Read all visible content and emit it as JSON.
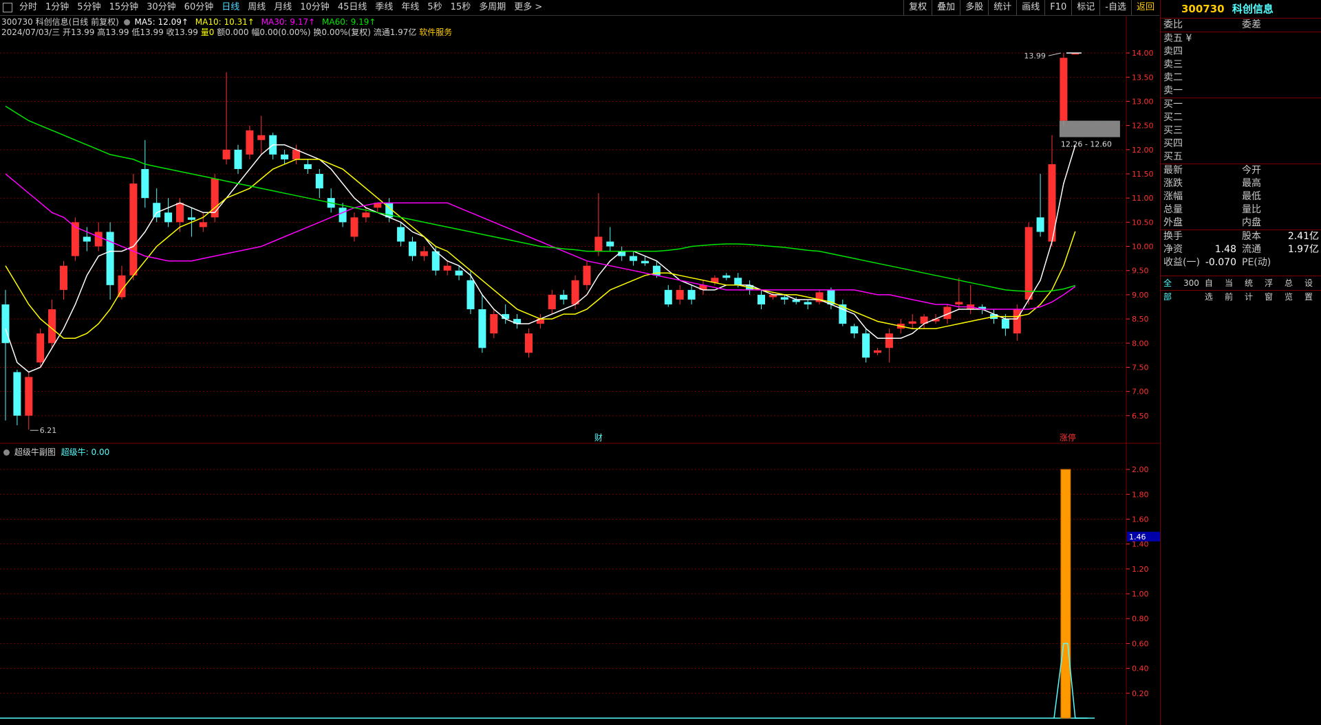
{
  "topbar": {
    "tabs": [
      "分时",
      "1分钟",
      "5分钟",
      "15分钟",
      "30分钟",
      "60分钟",
      "日线",
      "周线",
      "月线",
      "10分钟",
      "45日线",
      "季线",
      "年线",
      "5秒",
      "15秒",
      "多周期",
      "更多 >"
    ],
    "active": "日线"
  },
  "toolbar": {
    "buttons": [
      "复权",
      "叠加",
      "多股",
      "统计",
      "画线",
      "F10",
      "标记",
      "-自选",
      "返回"
    ]
  },
  "info1": {
    "stock": "300730 科创信息(日线 前复权)",
    "ma5": "MA5: 12.09↑",
    "ma10": "MA10: 10.31↑",
    "ma30": "MA30: 9.17↑",
    "ma60": "MA60: 9.19↑"
  },
  "info2": {
    "text": "2024/07/03/三 开13.99 高13.99 低13.99 收13.99",
    "vol": "量0",
    "amt": "额0.000",
    "rest": "幅0.00(0.00%) 换0.00%(复权) 流通1.97亿",
    "industry": "软件服务"
  },
  "subinfo": {
    "name": "超级牛副图",
    "value_label": "超级牛: 0.00"
  },
  "colors": {
    "up": "#ff3232",
    "down": "#54fcfc",
    "ma5": "#ffffff",
    "ma10": "#ffff00",
    "ma30": "#ff00ff",
    "ma60": "#00e600",
    "grid": "#7a0000",
    "axis": "#ff3232",
    "sub_bar": "#ff9900"
  },
  "annotations": {
    "high": "13.99",
    "low": "6.21",
    "band": "12.26 - 12.60",
    "cai": "财",
    "zt": "涨停",
    "sub_cursor": "1.46"
  },
  "chart_data": [
    {
      "type": "candlestick",
      "title": "300730 科创信息(日线 前复权)",
      "ylim": [
        6.0,
        14.3
      ],
      "y_ticks": [
        "14.00",
        "13.50",
        "13.00",
        "12.50",
        "12.00",
        "11.50",
        "11.00",
        "10.50",
        "10.00",
        "9.50",
        "9.00",
        "8.50",
        "8.00",
        "7.50",
        "7.00",
        "6.50"
      ],
      "candles": [
        [
          8.8,
          8.0,
          9.1,
          6.4
        ],
        [
          7.4,
          6.5,
          7.45,
          6.3
        ],
        [
          6.5,
          7.3,
          7.4,
          6.21
        ],
        [
          7.6,
          8.2,
          8.3,
          7.5
        ],
        [
          8.0,
          8.7,
          8.9,
          7.9
        ],
        [
          9.1,
          9.6,
          9.7,
          8.9
        ],
        [
          9.8,
          10.5,
          10.6,
          9.7
        ],
        [
          10.2,
          10.1,
          10.4,
          9.9
        ],
        [
          10.0,
          10.3,
          10.5,
          9.9
        ],
        [
          10.3,
          9.2,
          10.5,
          8.9
        ],
        [
          8.95,
          9.4,
          9.6,
          8.9
        ],
        [
          9.4,
          11.3,
          11.5,
          9.3
        ],
        [
          11.6,
          11.0,
          12.2,
          10.8
        ],
        [
          10.9,
          10.6,
          11.2,
          10.5
        ],
        [
          10.7,
          10.5,
          11.0,
          10.4
        ],
        [
          10.5,
          10.9,
          11.0,
          10.3
        ],
        [
          10.6,
          10.55,
          10.8,
          10.2
        ],
        [
          10.4,
          10.5,
          10.7,
          10.3
        ],
        [
          10.6,
          11.4,
          11.5,
          10.5
        ],
        [
          11.8,
          12.0,
          13.6,
          11.7
        ],
        [
          12.0,
          11.6,
          12.1,
          11.5
        ],
        [
          11.9,
          12.4,
          12.5,
          11.8
        ],
        [
          12.2,
          12.3,
          12.7,
          11.9
        ],
        [
          12.3,
          11.9,
          12.35,
          11.8
        ],
        [
          11.9,
          11.8,
          12.0,
          11.7
        ],
        [
          11.8,
          12.0,
          12.1,
          11.7
        ],
        [
          11.7,
          11.6,
          11.8,
          11.5
        ],
        [
          11.5,
          11.2,
          11.6,
          11.0
        ],
        [
          11.0,
          10.8,
          11.2,
          10.7
        ],
        [
          10.8,
          10.5,
          10.9,
          10.4
        ],
        [
          10.2,
          10.6,
          10.7,
          10.1
        ],
        [
          10.6,
          10.7,
          10.8,
          10.5
        ],
        [
          10.8,
          10.9,
          10.9,
          10.7
        ],
        [
          10.9,
          10.6,
          11.0,
          10.5
        ],
        [
          10.4,
          10.1,
          10.5,
          10.0
        ],
        [
          10.1,
          9.8,
          10.2,
          9.7
        ],
        [
          9.8,
          9.9,
          10.0,
          9.7
        ],
        [
          9.9,
          9.5,
          10.0,
          9.4
        ],
        [
          9.5,
          9.6,
          9.7,
          9.4
        ],
        [
          9.5,
          9.4,
          9.6,
          9.3
        ],
        [
          9.3,
          8.7,
          9.5,
          8.6
        ],
        [
          8.7,
          7.9,
          9.0,
          7.8
        ],
        [
          8.2,
          8.6,
          8.7,
          8.1
        ],
        [
          8.6,
          8.5,
          8.8,
          8.4
        ],
        [
          8.5,
          8.4,
          8.6,
          8.3
        ],
        [
          7.8,
          8.2,
          8.3,
          7.7
        ],
        [
          8.4,
          8.5,
          8.6,
          8.3
        ],
        [
          8.7,
          9.0,
          9.1,
          8.6
        ],
        [
          9.0,
          8.9,
          9.1,
          8.8
        ],
        [
          8.8,
          9.3,
          9.4,
          8.7
        ],
        [
          9.2,
          9.6,
          9.7,
          9.1
        ],
        [
          9.9,
          10.2,
          11.1,
          9.8
        ],
        [
          10.1,
          10.0,
          10.4,
          9.9
        ],
        [
          9.9,
          9.8,
          10.0,
          9.7
        ],
        [
          9.8,
          9.7,
          9.9,
          9.6
        ],
        [
          9.7,
          9.65,
          9.8,
          9.6
        ],
        [
          9.6,
          9.4,
          9.7,
          9.35
        ],
        [
          9.1,
          8.8,
          9.2,
          8.75
        ],
        [
          8.9,
          9.1,
          9.2,
          8.8
        ],
        [
          9.1,
          8.9,
          9.2,
          8.8
        ],
        [
          9.1,
          9.2,
          9.3,
          9.0
        ],
        [
          9.25,
          9.35,
          9.4,
          9.2
        ],
        [
          9.4,
          9.35,
          9.45,
          9.3
        ],
        [
          9.35,
          9.2,
          9.45,
          9.15
        ],
        [
          9.2,
          9.1,
          9.3,
          9.0
        ],
        [
          9.0,
          8.8,
          9.1,
          8.7
        ],
        [
          8.95,
          9.0,
          9.05,
          8.9
        ],
        [
          8.95,
          8.9,
          9.0,
          8.8
        ],
        [
          8.9,
          8.85,
          8.95,
          8.8
        ],
        [
          8.85,
          8.8,
          8.9,
          8.7
        ],
        [
          8.85,
          9.05,
          9.1,
          8.8
        ],
        [
          9.1,
          8.8,
          9.15,
          8.7
        ],
        [
          8.8,
          8.4,
          8.9,
          8.35
        ],
        [
          8.35,
          8.2,
          8.4,
          8.1
        ],
        [
          8.2,
          7.7,
          8.3,
          7.6
        ],
        [
          7.8,
          7.85,
          7.9,
          7.75
        ],
        [
          7.9,
          8.2,
          8.3,
          7.6
        ],
        [
          8.3,
          8.4,
          8.5,
          8.2
        ],
        [
          8.4,
          8.45,
          8.6,
          8.3
        ],
        [
          8.4,
          8.55,
          8.6,
          8.3
        ],
        [
          8.45,
          8.5,
          8.6,
          8.4
        ],
        [
          8.5,
          8.75,
          8.8,
          8.4
        ],
        [
          8.8,
          8.85,
          9.35,
          8.7
        ],
        [
          8.7,
          8.8,
          9.2,
          8.6
        ],
        [
          8.75,
          8.7,
          8.8,
          8.6
        ],
        [
          8.6,
          8.5,
          8.7,
          8.4
        ],
        [
          8.5,
          8.3,
          8.6,
          8.15
        ],
        [
          8.2,
          8.7,
          8.8,
          8.05
        ],
        [
          8.9,
          10.4,
          10.5,
          8.8
        ],
        [
          10.6,
          10.3,
          11.5,
          10.2
        ],
        [
          10.1,
          11.7,
          12.3,
          10.0
        ],
        [
          12.6,
          13.9,
          14.0,
          12.5
        ],
        [
          13.99,
          13.99,
          13.99,
          13.99
        ]
      ],
      "ma": {
        "MA5": [
          8.3,
          7.6,
          7.4,
          7.5,
          7.9,
          8.3,
          8.8,
          9.4,
          9.8,
          9.9,
          9.9,
          10.0,
          10.3,
          10.7,
          10.8,
          10.9,
          10.8,
          10.7,
          10.7,
          11.0,
          11.3,
          11.6,
          11.9,
          12.1,
          12.1,
          12.0,
          11.9,
          11.8,
          11.6,
          11.3,
          11.0,
          10.8,
          10.7,
          10.6,
          10.5,
          10.3,
          10.2,
          9.9,
          9.7,
          9.6,
          9.4,
          9.0,
          8.7,
          8.5,
          8.4,
          8.4,
          8.5,
          8.6,
          8.7,
          8.8,
          9.0,
          9.4,
          9.7,
          9.9,
          9.9,
          9.8,
          9.7,
          9.5,
          9.3,
          9.2,
          9.1,
          9.1,
          9.2,
          9.2,
          9.2,
          9.1,
          9.0,
          9.0,
          8.9,
          8.9,
          8.9,
          8.8,
          8.7,
          8.6,
          8.3,
          8.1,
          8.1,
          8.1,
          8.2,
          8.4,
          8.5,
          8.6,
          8.7,
          8.7,
          8.7,
          8.6,
          8.5,
          8.5,
          8.9,
          9.3,
          10.1,
          11.3,
          12.09
        ],
        "MA10": [
          9.6,
          9.2,
          8.8,
          8.5,
          8.3,
          8.1,
          8.1,
          8.2,
          8.4,
          8.7,
          9.1,
          9.4,
          9.7,
          10.0,
          10.2,
          10.4,
          10.5,
          10.6,
          10.8,
          11.0,
          11.1,
          11.2,
          11.4,
          11.6,
          11.7,
          11.8,
          11.8,
          11.8,
          11.7,
          11.6,
          11.4,
          11.2,
          11.0,
          10.8,
          10.6,
          10.4,
          10.2,
          10.0,
          9.9,
          9.7,
          9.5,
          9.3,
          9.1,
          8.9,
          8.7,
          8.6,
          8.5,
          8.5,
          8.6,
          8.6,
          8.7,
          8.9,
          9.1,
          9.2,
          9.3,
          9.4,
          9.45,
          9.45,
          9.4,
          9.35,
          9.3,
          9.25,
          9.2,
          9.2,
          9.15,
          9.1,
          9.05,
          9.0,
          9.0,
          8.95,
          8.9,
          8.85,
          8.75,
          8.65,
          8.55,
          8.45,
          8.4,
          8.35,
          8.3,
          8.3,
          8.3,
          8.35,
          8.4,
          8.45,
          8.5,
          8.55,
          8.55,
          8.55,
          8.6,
          8.8,
          9.1,
          9.6,
          10.31
        ],
        "MA30": [
          11.5,
          11.3,
          11.1,
          10.9,
          10.7,
          10.6,
          10.4,
          10.3,
          10.2,
          10.1,
          10.0,
          9.9,
          9.8,
          9.75,
          9.7,
          9.7,
          9.7,
          9.75,
          9.8,
          9.85,
          9.9,
          9.95,
          10.0,
          10.1,
          10.2,
          10.3,
          10.4,
          10.5,
          10.6,
          10.7,
          10.8,
          10.85,
          10.9,
          10.9,
          10.9,
          10.9,
          10.9,
          10.9,
          10.9,
          10.8,
          10.7,
          10.6,
          10.5,
          10.4,
          10.3,
          10.2,
          10.1,
          10.0,
          9.9,
          9.8,
          9.7,
          9.65,
          9.6,
          9.55,
          9.5,
          9.45,
          9.4,
          9.35,
          9.3,
          9.25,
          9.2,
          9.15,
          9.1,
          9.1,
          9.1,
          9.1,
          9.1,
          9.1,
          9.1,
          9.1,
          9.1,
          9.1,
          9.1,
          9.1,
          9.05,
          9.0,
          9.0,
          8.95,
          8.9,
          8.85,
          8.8,
          8.8,
          8.75,
          8.75,
          8.7,
          8.7,
          8.7,
          8.7,
          8.7,
          8.75,
          8.85,
          9.0,
          9.17
        ],
        "MA60": [
          12.9,
          12.75,
          12.6,
          12.5,
          12.4,
          12.3,
          12.2,
          12.1,
          12.0,
          11.9,
          11.85,
          11.8,
          11.7,
          11.65,
          11.6,
          11.55,
          11.5,
          11.45,
          11.4,
          11.35,
          11.3,
          11.25,
          11.2,
          11.15,
          11.1,
          11.05,
          11.0,
          10.95,
          10.9,
          10.85,
          10.8,
          10.75,
          10.7,
          10.65,
          10.6,
          10.55,
          10.5,
          10.45,
          10.4,
          10.35,
          10.3,
          10.25,
          10.2,
          10.15,
          10.1,
          10.05,
          10.0,
          9.98,
          9.95,
          9.93,
          9.9,
          9.9,
          9.9,
          9.9,
          9.9,
          9.9,
          9.9,
          9.92,
          9.95,
          10.0,
          10.02,
          10.04,
          10.05,
          10.05,
          10.04,
          10.02,
          10.0,
          9.98,
          9.95,
          9.92,
          9.9,
          9.85,
          9.8,
          9.75,
          9.7,
          9.65,
          9.6,
          9.55,
          9.5,
          9.45,
          9.4,
          9.35,
          9.3,
          9.25,
          9.2,
          9.15,
          9.1,
          9.08,
          9.07,
          9.07,
          9.08,
          9.12,
          9.19
        ]
      }
    },
    {
      "type": "bar",
      "title": "超级牛副图",
      "ylim": [
        0,
        2.1
      ],
      "y_ticks": [
        "2.00",
        "1.80",
        "1.60",
        "1.40",
        "1.20",
        "1.00",
        "0.80",
        "0.60",
        "0.40",
        "0.20"
      ],
      "bar_index": 91,
      "bar_value": 2.0,
      "line": {
        "index_start": 90,
        "peak_index": 91,
        "peak_value": 0.6,
        "index_end": 92
      }
    }
  ],
  "right_panel": {
    "code": "300730",
    "name": "科创信息",
    "header": [
      "委比",
      "委差"
    ],
    "sell": [
      "卖五 ¥",
      "卖四",
      "卖三",
      "卖二",
      "卖一"
    ],
    "buy": [
      "买一",
      "买二",
      "买三",
      "买四",
      "买五"
    ],
    "quote_left": [
      "最新",
      "涨跌",
      "涨幅",
      "总量",
      "外盘"
    ],
    "quote_right": [
      "今开",
      "最高",
      "最低",
      "量比",
      "内盘"
    ],
    "stats": [
      {
        "l": "换手",
        "v": "",
        "l2": "股本",
        "v2": "2.41亿"
      },
      {
        "l": "净资",
        "v": "1.48",
        "l2": "流通",
        "v2": "1.97亿"
      },
      {
        "l": "收益(一)",
        "v": "-0.070",
        "l2": "PE(动)",
        "v2": ""
      }
    ],
    "bottom_tabs": [
      "全部",
      "300",
      "自选",
      "当前",
      "统计",
      "浮窗",
      "总览",
      "设置"
    ]
  }
}
